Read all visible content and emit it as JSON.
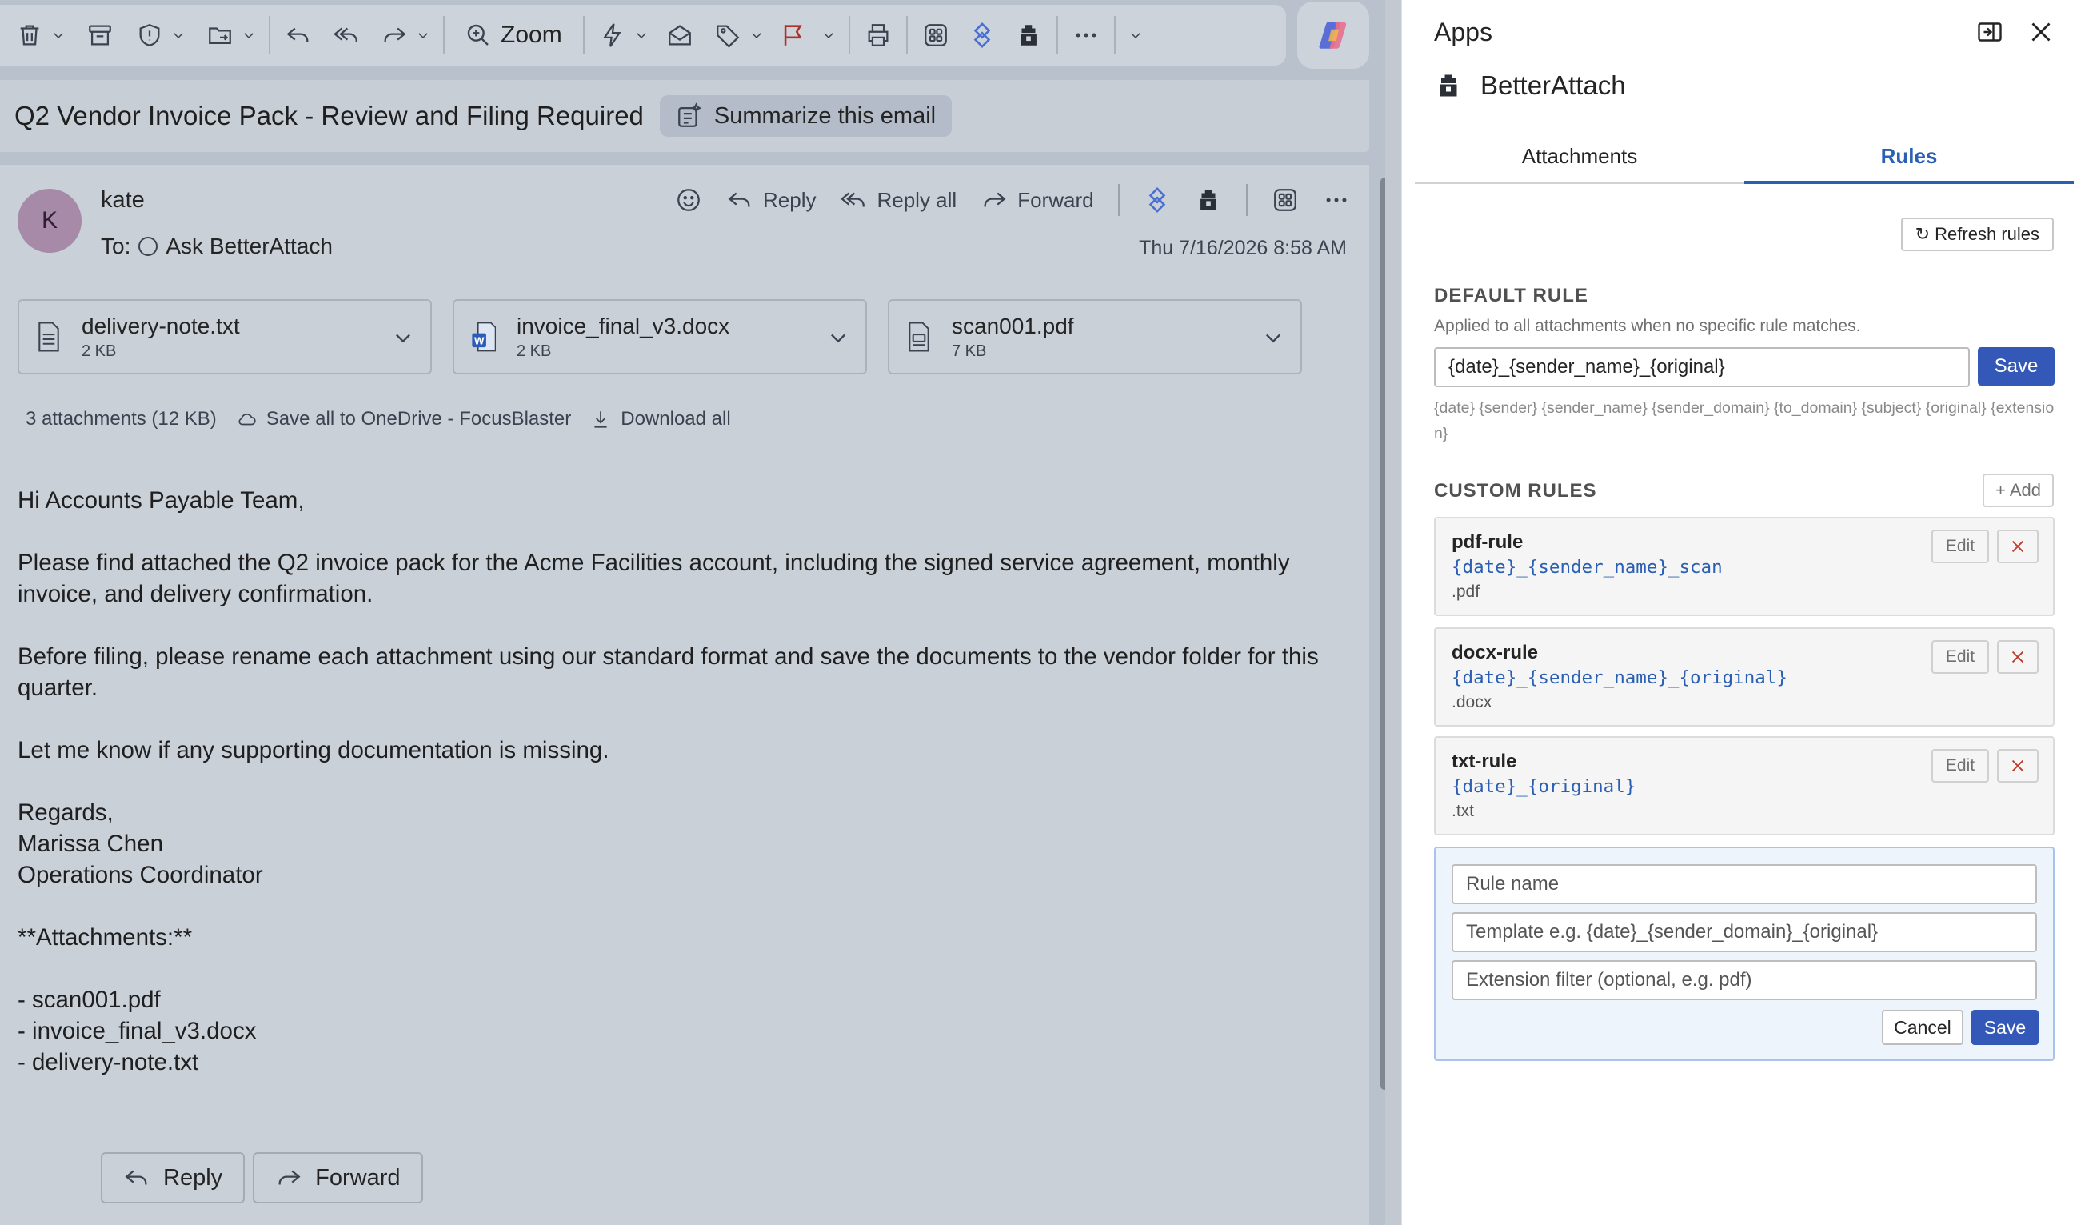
{
  "toolbar": {
    "zoom_label": "Zoom"
  },
  "email": {
    "subject": "Q2 Vendor Invoice Pack - Review and Filing Required",
    "summarize_label": "Summarize this email",
    "sender_initial": "K",
    "sender_name": "kate",
    "to_label": "To:",
    "to_recipient": "Ask BetterAttach",
    "date": "Thu 7/16/2026 8:58 AM",
    "actions": {
      "reply": "Reply",
      "reply_all": "Reply all",
      "forward": "Forward"
    },
    "attachments": [
      {
        "name": "delivery-note.txt",
        "size": "2 KB",
        "icon": "text-file-icon"
      },
      {
        "name": "invoice_final_v3.docx",
        "size": "2 KB",
        "icon": "word-file-icon"
      },
      {
        "name": "scan001.pdf",
        "size": "7 KB",
        "icon": "pdf-file-icon"
      }
    ],
    "attachment_summary": "3 attachments (12 KB)",
    "save_all_label": "Save all to OneDrive - FocusBlaster",
    "download_all_label": "Download all",
    "body": "Hi Accounts Payable Team,\n\nPlease find attached the Q2 invoice pack for the Acme Facilities account, including the signed service agreement, monthly invoice, and delivery confirmation.\n\nBefore filing, please rename each attachment using our standard format and save the documents to the vendor folder for this quarter.\n\nLet me know if any supporting documentation is missing.\n\nRegards,\nMarissa Chen\nOperations Coordinator\n\n**Attachments:**\n\n- scan001.pdf\n- invoice_final_v3.docx\n- delivery-note.txt",
    "bottom_reply": "Reply",
    "bottom_forward": "Forward"
  },
  "panel": {
    "title": "Apps",
    "app_name": "BetterAttach",
    "tabs": [
      {
        "label": "Attachments",
        "active": false
      },
      {
        "label": "Rules",
        "active": true
      }
    ],
    "refresh_label": "↻ Refresh rules",
    "default_rule": {
      "heading": "DEFAULT RULE",
      "description": "Applied to all attachments when no specific rule matches.",
      "value": "{date}_{sender_name}_{original}",
      "save_label": "Save",
      "placeholders": "{date} {sender} {sender_name} {sender_domain} {to_domain} {subject} {original} {extension}"
    },
    "custom_rules": {
      "heading": "CUSTOM RULES",
      "add_label": "+ Add",
      "edit_label": "Edit",
      "rules": [
        {
          "name": "pdf-rule",
          "template": "{date}_{sender_name}_scan",
          "extension": ".pdf"
        },
        {
          "name": "docx-rule",
          "template": "{date}_{sender_name}_{original}",
          "extension": ".docx"
        },
        {
          "name": "txt-rule",
          "template": "{date}_{original}",
          "extension": ".txt"
        }
      ]
    },
    "new_rule": {
      "name_placeholder": "Rule name",
      "template_placeholder": "Template e.g. {date}_{sender_domain}_{original}",
      "extension_placeholder": "Extension filter (optional, e.g. pdf)",
      "cancel_label": "Cancel",
      "save_label": "Save"
    }
  },
  "colors": {
    "accent": "#3358b8",
    "tab_active": "#2b5fb3",
    "flag": "#c0392b"
  }
}
